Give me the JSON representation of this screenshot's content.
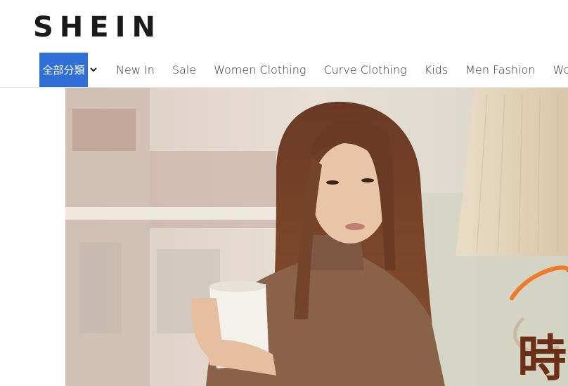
{
  "header": {
    "logo_text": "SHEIN"
  },
  "nav": {
    "all_categories_label": "全部分類",
    "items": [
      {
        "label": "New In"
      },
      {
        "label": "Sale"
      },
      {
        "label": "Women Clothing"
      },
      {
        "label": "Curve Clothing"
      },
      {
        "label": "Kids"
      },
      {
        "label": "Men Fashion"
      },
      {
        "label": "Wome"
      }
    ]
  },
  "hero": {
    "overlay_char": "時",
    "colors": {
      "accent_blue": "#2f6fd6",
      "banner_orange": "#f07a2a",
      "banner_brown": "#6b2f17"
    }
  }
}
